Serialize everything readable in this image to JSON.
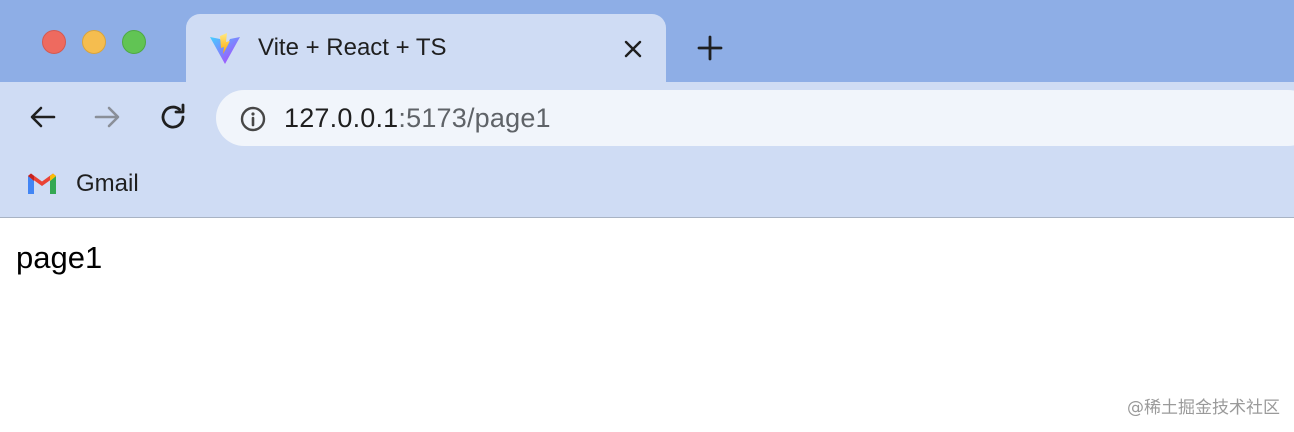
{
  "window": {
    "controls": [
      "close",
      "minimize",
      "zoom"
    ]
  },
  "tab": {
    "title": "Vite + React + TS",
    "favicon": "vite-logo-icon",
    "close_icon": "close-icon",
    "new_tab_icon": "plus-icon"
  },
  "toolbar": {
    "back_icon": "arrow-left-icon",
    "forward_icon": "arrow-right-icon",
    "reload_icon": "reload-icon",
    "site_info_icon": "info-icon",
    "url_host": "127.0.0.1",
    "url_rest": ":5173/page1"
  },
  "bookmarks": {
    "items": [
      {
        "label": "Gmail",
        "icon": "gmail-icon"
      }
    ]
  },
  "page": {
    "heading": "page1"
  },
  "watermark": "@稀土掘金技术社区",
  "colors": {
    "tabstrip": "#8eaee6",
    "toolbar": "#cfdcf4",
    "omnibox": "#f1f5fb",
    "close_button": "#ee6a5f",
    "minimize_button": "#f5bd4f",
    "zoom_button": "#61c454"
  }
}
